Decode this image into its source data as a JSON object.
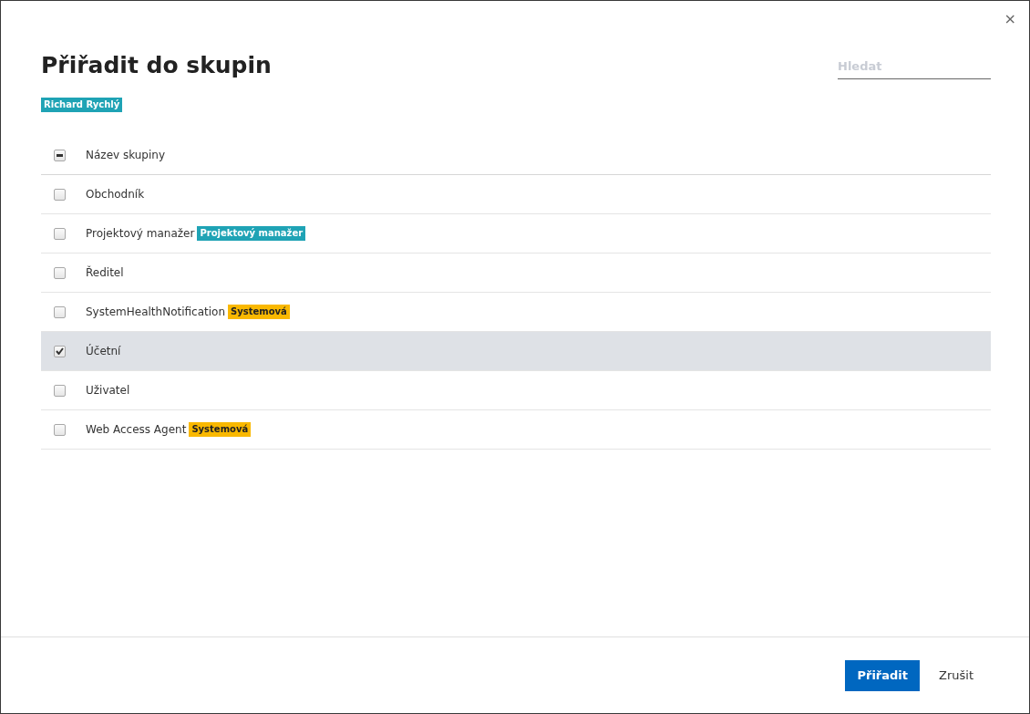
{
  "dialog": {
    "title": "Přiřadit do skupin",
    "close": "×",
    "user_tag": "Richard Rychlý",
    "search": {
      "placeholder": "Hledat"
    }
  },
  "table": {
    "header": {
      "label": "Název skupiny",
      "indeterminate": true
    },
    "rows": [
      {
        "name": "Obchodník",
        "checked": false,
        "selected": false
      },
      {
        "name": "Projektový manažer",
        "checked": false,
        "selected": false,
        "tag": {
          "kind": "role",
          "text": "Projektový manažer"
        }
      },
      {
        "name": "Ředitel",
        "checked": false,
        "selected": false
      },
      {
        "name": "SystemHealthNotification",
        "checked": false,
        "selected": false,
        "tag": {
          "kind": "system",
          "text": "Systemová"
        }
      },
      {
        "name": "Účetní",
        "checked": true,
        "selected": true
      },
      {
        "name": "Uživatel",
        "checked": false,
        "selected": false
      },
      {
        "name": "Web Access Agent",
        "checked": false,
        "selected": false,
        "tag": {
          "kind": "system",
          "text": "Systemová"
        }
      }
    ]
  },
  "buttons": [
    {
      "kind": "primary",
      "label": "Přiřadit"
    },
    {
      "kind": "link",
      "label": "Zrušit"
    }
  ]
}
